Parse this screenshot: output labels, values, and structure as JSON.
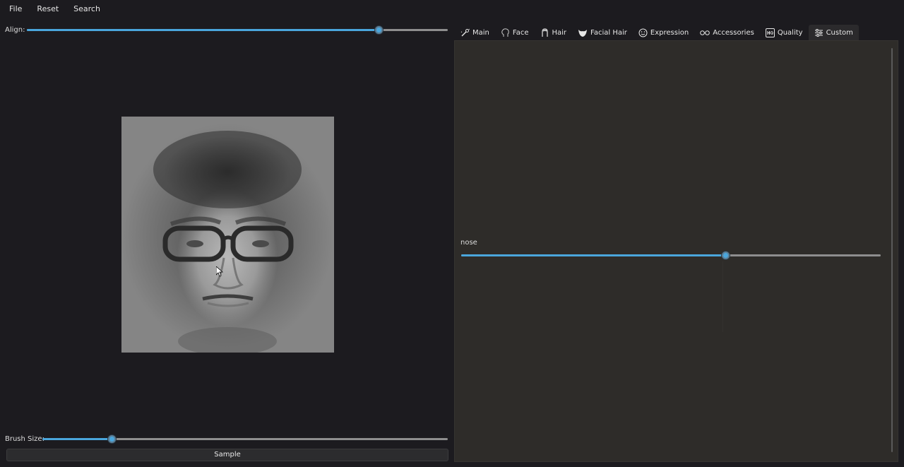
{
  "menu": {
    "file": "File",
    "reset": "Reset",
    "search": "Search"
  },
  "align": {
    "label": "Align:",
    "value": 0.835
  },
  "brush_size": {
    "label": "Brush Size:",
    "value": 0.17
  },
  "sample_button": "Sample",
  "tabs": [
    {
      "label": "Main",
      "icon": "wand-icon"
    },
    {
      "label": "Face",
      "icon": "head-outline-icon"
    },
    {
      "label": "Hair",
      "icon": "hair-icon"
    },
    {
      "label": "Facial Hair",
      "icon": "beard-icon"
    },
    {
      "label": "Expression",
      "icon": "smiley-icon"
    },
    {
      "label": "Accessories",
      "icon": "glasses-icon"
    },
    {
      "label": "Quality",
      "icon": "hq-icon"
    },
    {
      "label": "Custom",
      "icon": "sliders-icon"
    }
  ],
  "active_tab": "Custom",
  "custom": {
    "nose_label": "nose",
    "nose_value": 0.63
  },
  "colors": {
    "accent": "#4aa6dc",
    "background": "#1c1b1f",
    "panel": "#2e2c29"
  }
}
